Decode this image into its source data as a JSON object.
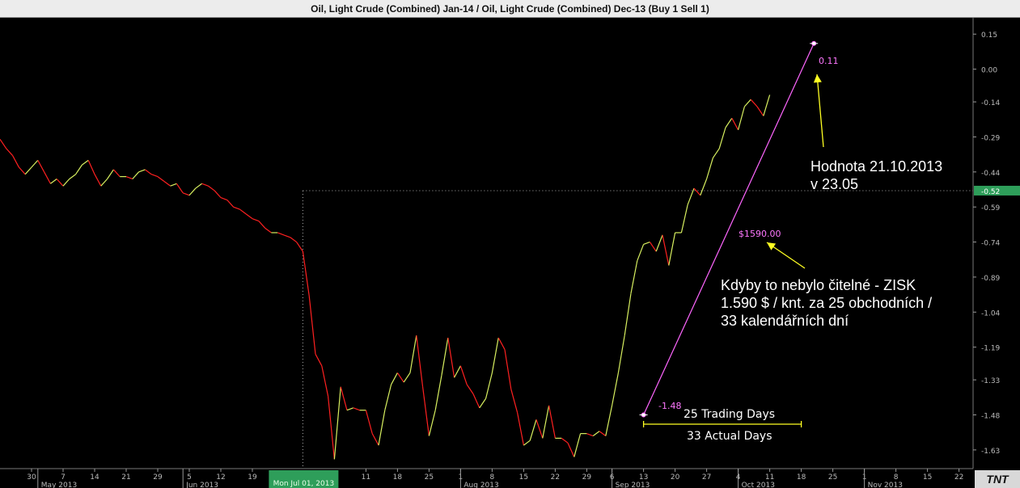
{
  "title": "Oil, Light Crude (Combined) Jan-14  / Oil, Light Crude (Combined) Dec-13 (Buy 1 Sell 1)",
  "colors": {
    "background": "#000000",
    "up": "#d8f060",
    "down": "#ff2020",
    "trend": "#ff66ff",
    "arrow": "#ffff22",
    "axis_text": "#bbbbbb",
    "last_badge": "#2e9e5a",
    "cursor_badge": "#2e9e5a"
  },
  "chart_data": {
    "type": "line",
    "title": "Oil, Light Crude (Combined) Jan-14  / Oil, Light Crude (Combined) Dec-13 (Buy 1 Sell 1)",
    "x_unit": "trading-day index",
    "ylim": [
      -1.71,
      0.22
    ],
    "y_ticks": [
      "0.15",
      "0.00",
      "-0.14",
      "-0.29",
      "-0.44",
      "-0.59",
      "-0.74",
      "-0.89",
      "-1.04",
      "-1.19",
      "-1.33",
      "-1.48",
      "-1.63"
    ],
    "y_tick_values": [
      0.15,
      0.0,
      -0.14,
      -0.29,
      -0.44,
      -0.59,
      -0.74,
      -0.89,
      -1.04,
      -1.19,
      -1.33,
      -1.48,
      -1.63
    ],
    "last_value_badge": "-0.52",
    "x_ticks": [
      {
        "label": "30",
        "i": 5
      },
      {
        "label": "7",
        "i": 10
      },
      {
        "label": "14",
        "i": 15
      },
      {
        "label": "21",
        "i": 20
      },
      {
        "label": "29",
        "i": 25
      },
      {
        "label": "5",
        "i": 30
      },
      {
        "label": "12",
        "i": 35
      },
      {
        "label": "19",
        "i": 40
      },
      {
        "label": "11",
        "i": 58
      },
      {
        "label": "18",
        "i": 63
      },
      {
        "label": "25",
        "i": 68
      },
      {
        "label": "1",
        "i": 73
      },
      {
        "label": "8",
        "i": 78
      },
      {
        "label": "15",
        "i": 83
      },
      {
        "label": "22",
        "i": 88
      },
      {
        "label": "29",
        "i": 93
      },
      {
        "label": "6",
        "i": 97
      },
      {
        "label": "13",
        "i": 102
      },
      {
        "label": "20",
        "i": 107
      },
      {
        "label": "27",
        "i": 112
      },
      {
        "label": "4",
        "i": 117
      },
      {
        "label": "11",
        "i": 122
      },
      {
        "label": "18",
        "i": 127
      },
      {
        "label": "25",
        "i": 132
      },
      {
        "label": "1",
        "i": 137
      },
      {
        "label": "8",
        "i": 142
      },
      {
        "label": "15",
        "i": 147
      },
      {
        "label": "22",
        "i": 152
      }
    ],
    "month_labels": [
      {
        "label": "May 2013",
        "i": 6
      },
      {
        "label": "Jun 2013",
        "i": 29
      },
      {
        "label": "Aug 2013",
        "i": 73
      },
      {
        "label": "Sep 2013",
        "i": 97
      },
      {
        "label": "Oct 2013",
        "i": 117
      },
      {
        "label": "Nov 2013",
        "i": 137
      }
    ],
    "cursor": {
      "label": "Mon Jul 01, 2013",
      "i": 48
    },
    "cursor_level": -0.52,
    "series": [
      {
        "values": [
          -0.3,
          -0.34,
          -0.37,
          -0.42,
          -0.45,
          -0.42,
          -0.39,
          -0.44,
          -0.49,
          -0.47,
          -0.5,
          -0.47,
          -0.45,
          -0.41,
          -0.39,
          -0.45,
          -0.5,
          -0.47,
          -0.43,
          -0.46,
          -0.46,
          -0.47,
          -0.44,
          -0.43,
          -0.45,
          -0.46,
          -0.48,
          -0.5,
          -0.49,
          -0.53,
          -0.54,
          -0.51,
          -0.49,
          -0.5,
          -0.52,
          -0.55,
          -0.56,
          -0.59,
          -0.6,
          -0.62,
          -0.64,
          -0.65,
          -0.68,
          -0.7,
          -0.7,
          -0.71,
          -0.72,
          -0.74,
          -0.78,
          -0.97,
          -1.22,
          -1.27,
          -1.4,
          -1.67,
          -1.36,
          -1.46,
          -1.45,
          -1.46,
          -1.46,
          -1.56,
          -1.61,
          -1.46,
          -1.35,
          -1.3,
          -1.34,
          -1.3,
          -1.14,
          -1.36,
          -1.57,
          -1.46,
          -1.31,
          -1.15,
          -1.32,
          -1.27,
          -1.35,
          -1.39,
          -1.45,
          -1.41,
          -1.3,
          -1.15,
          -1.2,
          -1.37,
          -1.47,
          -1.61,
          -1.59,
          -1.5,
          -1.58,
          -1.44,
          -1.58,
          -1.58,
          -1.6,
          -1.66,
          -1.56,
          -1.56,
          -1.57,
          -1.55,
          -1.57,
          -1.44,
          -1.3,
          -1.14,
          -0.96,
          -0.82,
          -0.75,
          -0.74,
          -0.78,
          -0.71,
          -0.84,
          -0.7,
          -0.7,
          -0.58,
          -0.51,
          -0.54,
          -0.47,
          -0.38,
          -0.34,
          -0.25,
          -0.21,
          -0.26,
          -0.16,
          -0.13,
          -0.16,
          -0.2,
          -0.11
        ]
      }
    ],
    "trend_line": {
      "start": {
        "i": 102,
        "value": -1.48,
        "label": "-1.48"
      },
      "end": {
        "i": 129,
        "value": 0.11,
        "label": "0.11"
      }
    },
    "profit_label": "$1590.00",
    "range_bar": {
      "from_i": 102,
      "to_i": 127,
      "top_label": "25 Trading Days",
      "bottom_label": "33 Actual Days"
    }
  },
  "annotations": {
    "date_value": [
      "Hodnota 21.10.2013",
      "v 23.05"
    ],
    "profit_note": [
      "Kdyby to nebylo čitelné - ZISK",
      "1.590 $ / knt. za 25 obchodních /",
      "33 kalendářních dní"
    ]
  },
  "logo": "TNT"
}
